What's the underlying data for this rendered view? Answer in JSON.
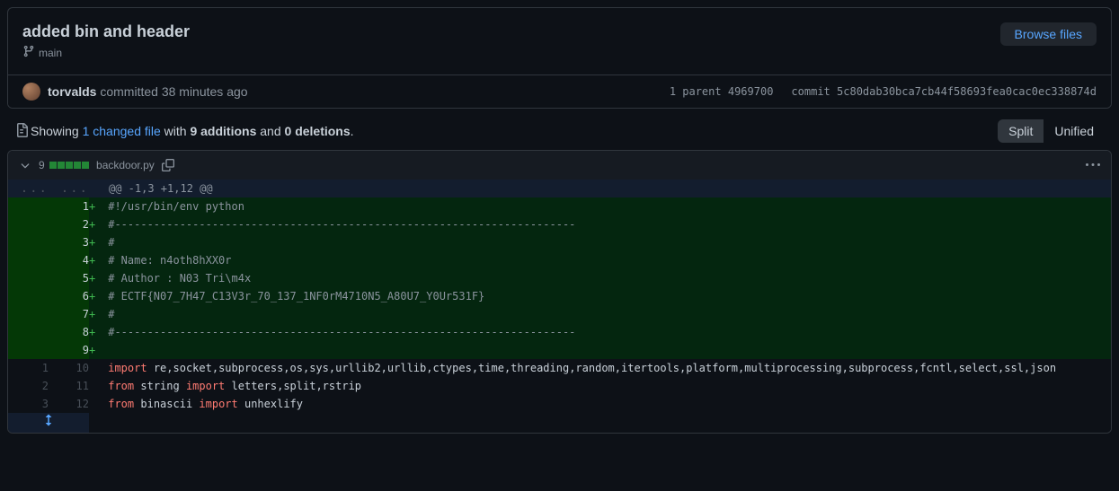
{
  "commit": {
    "title": "added bin and header",
    "branch": "main",
    "browse_files": "Browse files",
    "author": "torvalds",
    "committed_text": "committed 38 minutes ago",
    "parent_label": "1 parent",
    "parent_hash": "4969700",
    "commit_label": "commit",
    "commit_hash": "5c80dab30bca7cb44f58693fea0cac0ec338874d"
  },
  "stats": {
    "showing": "Showing ",
    "files_link": "1 changed file",
    "with": " with ",
    "additions": "9 additions",
    "and": " and ",
    "deletions": "0 deletions",
    "period": "."
  },
  "view": {
    "split": "Split",
    "unified": "Unified"
  },
  "file": {
    "change_count": "9",
    "filename": "backdoor.py"
  },
  "hunk": {
    "dots": "...",
    "header": "@@ -1,3 +1,12 @@"
  },
  "lines": [
    {
      "type": "add",
      "old": "",
      "new": "1",
      "marker": "+",
      "segs": [
        {
          "t": "#!/usr/bin/env python",
          "c": "c1"
        }
      ]
    },
    {
      "type": "add",
      "old": "",
      "new": "2",
      "marker": "+",
      "segs": [
        {
          "t": "#-----------------------------------------------------------------------",
          "c": "c1"
        }
      ]
    },
    {
      "type": "add",
      "old": "",
      "new": "3",
      "marker": "+",
      "segs": [
        {
          "t": "#",
          "c": "c1"
        }
      ]
    },
    {
      "type": "add",
      "old": "",
      "new": "4",
      "marker": "+",
      "segs": [
        {
          "t": "# Name: n4oth8hXX0r",
          "c": "c1"
        }
      ]
    },
    {
      "type": "add",
      "old": "",
      "new": "5",
      "marker": "+",
      "segs": [
        {
          "t": "# Author : N03 Tri\\m4x",
          "c": "c1"
        }
      ]
    },
    {
      "type": "add",
      "old": "",
      "new": "6",
      "marker": "+",
      "segs": [
        {
          "t": "# ECTF{N07_7H47_C13V3r_70_137_1NF0rM4710N5_A80U7_Y0Ur531F}",
          "c": "c1"
        }
      ]
    },
    {
      "type": "add",
      "old": "",
      "new": "7",
      "marker": "+",
      "segs": [
        {
          "t": "#",
          "c": "c1"
        }
      ]
    },
    {
      "type": "add",
      "old": "",
      "new": "8",
      "marker": "+",
      "segs": [
        {
          "t": "#-----------------------------------------------------------------------",
          "c": "c1"
        }
      ]
    },
    {
      "type": "add",
      "old": "",
      "new": "9",
      "marker": "+",
      "segs": [
        {
          "t": "",
          "c": ""
        }
      ]
    },
    {
      "type": "ctx",
      "old": "1",
      "new": "10",
      "marker": " ",
      "segs": [
        {
          "t": "import",
          "c": "kwr"
        },
        {
          "t": " re,socket,subprocess,os,sys,urllib2,urllib,ctypes,time,threading,random,itertools,platform,multiprocessing,subprocess,fcntl,select,ssl,json",
          "c": ""
        }
      ]
    },
    {
      "type": "ctx",
      "old": "2",
      "new": "11",
      "marker": " ",
      "segs": [
        {
          "t": "from",
          "c": "kwr"
        },
        {
          "t": " string ",
          "c": ""
        },
        {
          "t": "import",
          "c": "kwr"
        },
        {
          "t": " letters,split,rstrip",
          "c": ""
        }
      ]
    },
    {
      "type": "ctx",
      "old": "3",
      "new": "12",
      "marker": " ",
      "segs": [
        {
          "t": "from",
          "c": "kwr"
        },
        {
          "t": " binascii ",
          "c": ""
        },
        {
          "t": "import",
          "c": "kwr"
        },
        {
          "t": " unhexlify",
          "c": ""
        }
      ]
    }
  ]
}
